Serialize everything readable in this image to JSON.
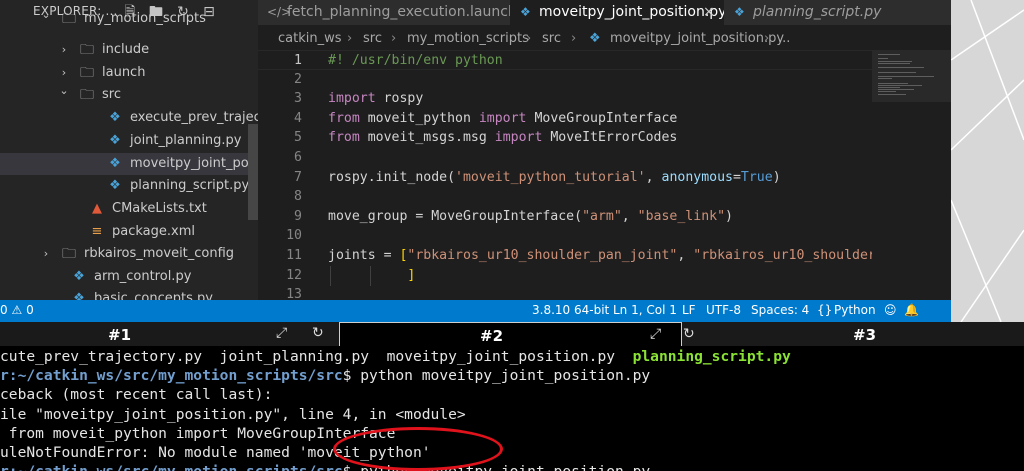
{
  "explorer": {
    "title": "EXPLORER: ...",
    "tree": [
      {
        "label": "my_motion_scripts",
        "type": "folder"
      },
      {
        "label": "include",
        "type": "folder"
      },
      {
        "label": "launch",
        "type": "folder"
      },
      {
        "label": "src",
        "type": "folder"
      },
      {
        "label": "execute_prev_trajec...",
        "type": "py"
      },
      {
        "label": "joint_planning.py",
        "type": "py"
      },
      {
        "label": "moveitpy_joint_posit...",
        "type": "py"
      },
      {
        "label": "planning_script.py",
        "type": "py"
      },
      {
        "label": "CMakeLists.txt",
        "type": "cmake"
      },
      {
        "label": "package.xml",
        "type": "xml"
      },
      {
        "label": "rbkairos_moveit_config",
        "type": "folder"
      },
      {
        "label": "arm_control.py",
        "type": "py"
      },
      {
        "label": "basic_concepts.py",
        "type": "py"
      }
    ]
  },
  "tabs": [
    {
      "label": "fetch_planning_execution.launch"
    },
    {
      "label": "moveitpy_joint_position.py",
      "close": "×"
    },
    {
      "label": "planning_script.py"
    }
  ],
  "breadcrumb": [
    "catkin_ws",
    "src",
    "my_motion_scripts",
    "src",
    "moveitpy_joint_position.py",
    "..."
  ],
  "editor": {
    "lines": [
      {
        "n": "1",
        "parts": [
          {
            "t": "#! /usr/bin/env python",
            "c": "cm"
          }
        ]
      },
      {
        "n": "2",
        "parts": []
      },
      {
        "n": "3",
        "parts": [
          {
            "t": "import",
            "c": "kw"
          },
          {
            "t": " rospy",
            "c": "id"
          }
        ]
      },
      {
        "n": "4",
        "parts": [
          {
            "t": "from",
            "c": "kw"
          },
          {
            "t": " moveit_python ",
            "c": "id"
          },
          {
            "t": "import",
            "c": "kw"
          },
          {
            "t": " MoveGroupInterface",
            "c": "id"
          }
        ]
      },
      {
        "n": "5",
        "parts": [
          {
            "t": "from",
            "c": "kw"
          },
          {
            "t": " moveit_msgs.msg ",
            "c": "id"
          },
          {
            "t": "import",
            "c": "kw"
          },
          {
            "t": " MoveItErrorCodes",
            "c": "id"
          }
        ]
      },
      {
        "n": "6",
        "parts": []
      },
      {
        "n": "7",
        "parts": [
          {
            "t": "rospy.init_node(",
            "c": "id"
          },
          {
            "t": "'moveit_python_tutorial'",
            "c": "str"
          },
          {
            "t": ", ",
            "c": "id"
          },
          {
            "t": "anonymous",
            "c": "par"
          },
          {
            "t": "=",
            "c": "id"
          },
          {
            "t": "True",
            "c": "bool"
          },
          {
            "t": ")",
            "c": "id"
          }
        ]
      },
      {
        "n": "8",
        "parts": []
      },
      {
        "n": "9",
        "parts": [
          {
            "t": "move_group = MoveGroupInterface(",
            "c": "id"
          },
          {
            "t": "\"arm\"",
            "c": "str"
          },
          {
            "t": ", ",
            "c": "id"
          },
          {
            "t": "\"base_link\"",
            "c": "str"
          },
          {
            "t": ")",
            "c": "id"
          }
        ]
      },
      {
        "n": "10",
        "parts": []
      },
      {
        "n": "11",
        "parts": [
          {
            "t": "joints = ",
            "c": "id"
          },
          {
            "t": "[",
            "c": "br"
          },
          {
            "t": "\"rbkairos_ur10_shoulder_pan_joint\"",
            "c": "str"
          },
          {
            "t": ", ",
            "c": "id"
          },
          {
            "t": "\"rbkairos_ur10_shoulder",
            "c": "str"
          }
        ]
      },
      {
        "n": "12",
        "parts": [
          {
            "t": "          ",
            "c": "id"
          },
          {
            "t": "]",
            "c": "br"
          }
        ]
      },
      {
        "n": "13",
        "parts": []
      }
    ]
  },
  "status": {
    "problems": "0",
    "warnings": "0",
    "interpreter": "3.8.10 64-bit",
    "position": "Ln 1, Col 1",
    "eol": "LF",
    "encoding": "UTF-8",
    "spaces": "Spaces: 4",
    "language": "Python"
  },
  "terminal_tabs": [
    {
      "label": "#1"
    },
    {
      "label": "#2"
    },
    {
      "label": "#3"
    }
  ],
  "terminal": {
    "lines": [
      {
        "parts": [
          {
            "t": "cute_prev_trajectory.py  joint_planning.py  moveitpy_joint_position.py  ",
            "c": ""
          },
          {
            "t": "planning_script.py",
            "c": "tgreen"
          }
        ]
      },
      {
        "parts": [
          {
            "t": "r:~/catkin_ws/src/my_motion_scripts/src",
            "c": "tblue"
          },
          {
            "t": "$ python moveitpy_joint_position.py",
            "c": ""
          }
        ]
      },
      {
        "parts": [
          {
            "t": "ceback (most recent call last):",
            "c": ""
          }
        ]
      },
      {
        "parts": [
          {
            "t": "ile \"moveitpy_joint_position.py\", line 4, in <module>",
            "c": ""
          }
        ]
      },
      {
        "parts": [
          {
            "t": " from moveit_python import MoveGroupInterface",
            "c": ""
          }
        ]
      },
      {
        "parts": [
          {
            "t": "uleNotFoundError: No module named 'moveit_python'",
            "c": ""
          }
        ]
      },
      {
        "parts": [
          {
            "t": "r:~/catkin_ws/src/my_motion_scripts/src",
            "c": "tblue"
          },
          {
            "t": "$ python moveitpy_joint_position.py",
            "c": ""
          }
        ]
      }
    ]
  },
  "colors": {
    "statusbar": "#007acc",
    "annotation": "#e0121b",
    "terminal_green": "#8ae234",
    "terminal_blue": "#729fcf"
  }
}
